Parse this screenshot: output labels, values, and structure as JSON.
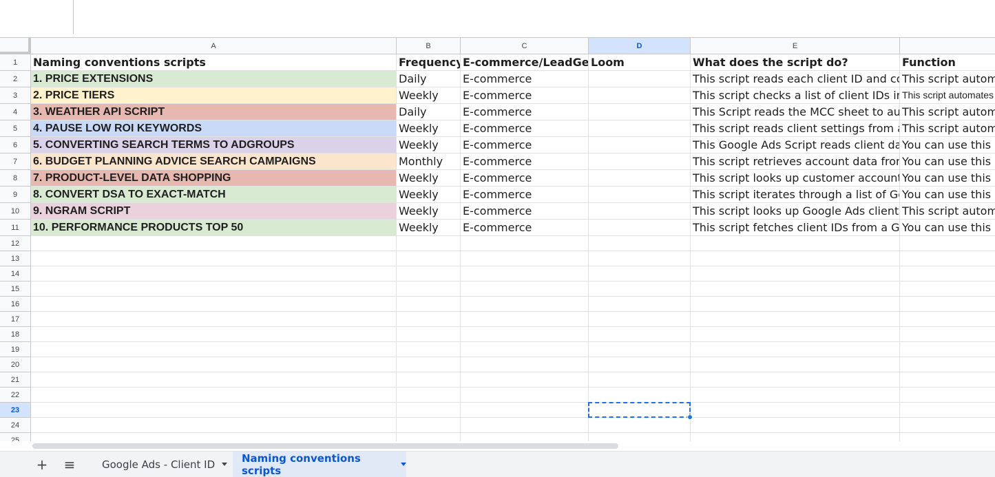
{
  "colors": {
    "accent": "#1a73e8",
    "selected_header": "#d3e3fd",
    "green": "#d9ead3",
    "yellow": "#fff2cc",
    "red": "#e6b8af",
    "blue": "#c9daf8",
    "purple": "#d9d2e9",
    "orange": "#fce5cd",
    "pink": "#ead1dc"
  },
  "columns": [
    "A",
    "B",
    "C",
    "D",
    "E",
    ""
  ],
  "rows": [
    "1",
    "2",
    "3",
    "4",
    "5",
    "6",
    "7",
    "8",
    "9",
    "10",
    "11",
    "12",
    "13",
    "14",
    "15",
    "16",
    "17",
    "18",
    "19",
    "20",
    "21",
    "22",
    "23",
    "24",
    "25"
  ],
  "selected_cell": {
    "column": "D",
    "row": "23"
  },
  "header_row": [
    "Naming conventions scripts",
    "Frequency",
    "E-commerce/LeadGen",
    "Loom",
    "What does the script do?",
    "Function"
  ],
  "data_rows": [
    {
      "name": "1. PRICE EXTENSIONS",
      "frequency": "Daily",
      "type": "E-commerce",
      "loom": "",
      "what": "This script reads each client ID and configuration",
      "function": "This script automates",
      "color": "#d9ead3"
    },
    {
      "name": "2. PRICE TIERS",
      "frequency": "Weekly",
      "type": "E-commerce",
      "loom": "",
      "what": "This script checks a list of client IDs in a sheet",
      "function": "This script automates the",
      "color": "#fff2cc"
    },
    {
      "name": "3. WEATHER API SCRIPT",
      "frequency": "Daily",
      "type": "E-commerce",
      "loom": "",
      "what": "This Script reads the MCC sheet to automatically",
      "function": "This script automates",
      "color": "#e6b8af"
    },
    {
      "name": "4. PAUSE LOW ROI KEYWORDS",
      "frequency": "Weekly",
      "type": "E-commerce",
      "loom": "",
      "what": "This script reads client settings from a master",
      "function": "This script automates",
      "color": "#c9daf8"
    },
    {
      "name": "5. CONVERTING SEARCH TERMS TO ADGROUPS",
      "frequency": "Weekly",
      "type": "E-commerce",
      "loom": "",
      "what": "This Google Ads Script reads client data",
      "function": "You can use this script",
      "color": "#d9d2e9"
    },
    {
      "name": "6. BUDGET PLANNING ADVICE SEARCH CAMPAIGNS",
      "frequency": "Monthly",
      "type": "E-commerce",
      "loom": "",
      "what": "This script retrieves account data from a sheet",
      "function": "You can use this script",
      "color": "#fce5cd"
    },
    {
      "name": "7. PRODUCT-LEVEL DATA SHOPPING",
      "frequency": "Weekly",
      "type": "E-commerce",
      "loom": "",
      "what": "This script looks up customer accounts",
      "function": "You can use this script",
      "color": "#e6b8af"
    },
    {
      "name": "8. CONVERT DSA TO EXACT-MATCH",
      "frequency": "Weekly",
      "type": "E-commerce",
      "loom": "",
      "what": "This script iterates through a list of Google Ads",
      "function": "You can use this script",
      "color": "#d9ead3"
    },
    {
      "name": "9. NGRAM SCRIPT",
      "frequency": "Weekly",
      "type": "E-commerce",
      "loom": "",
      "what": "This script looks up Google Ads client IDs",
      "function": "This script automates",
      "color": "#ead1dc"
    },
    {
      "name": "10. PERFORMANCE PRODUCTS TOP 50",
      "frequency": "Weekly",
      "type": "E-commerce",
      "loom": "",
      "what": "This script fetches client IDs from a Google Sheet",
      "function": "You can use this script",
      "color": "#d9ead3"
    }
  ],
  "tabbar": {
    "add_icon": "+",
    "menu_icon": "≡",
    "tabs": [
      {
        "label": "Google Ads - Client ID",
        "active": false
      },
      {
        "label": "Naming conventions scripts",
        "active": true
      }
    ]
  }
}
